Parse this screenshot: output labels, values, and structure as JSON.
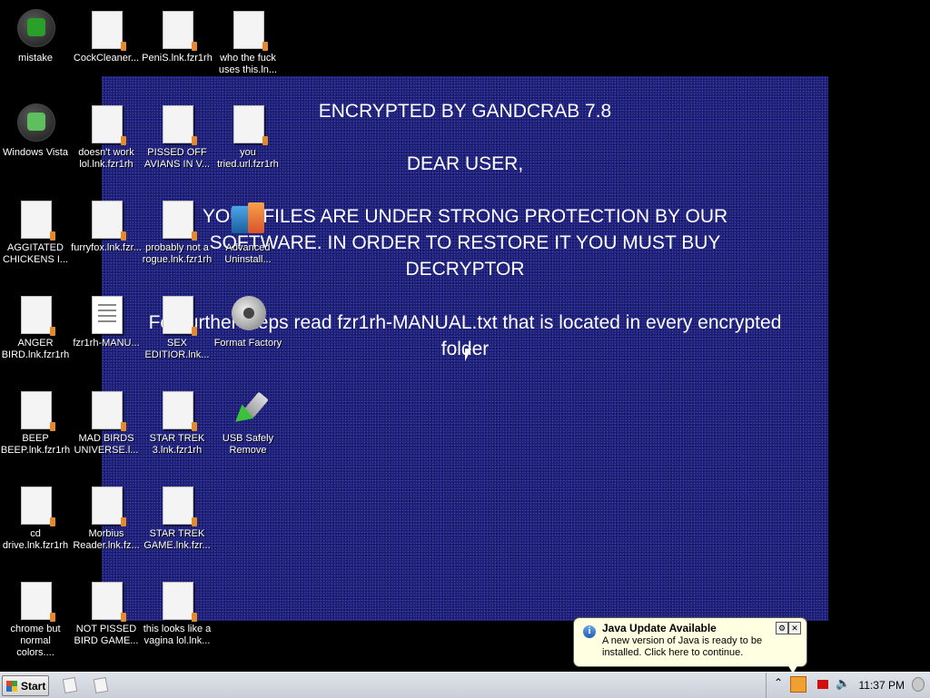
{
  "wallpaper": {
    "lines": [
      "ENCRYPTED BY GANDCRAB 7.8",
      "DEAR USER,",
      "YOUR FILES ARE UNDER STRONG PROTECTION BY OUR",
      "SOFTWARE. IN ORDER TO RESTORE IT YOU MUST BUY",
      "DECRYPTOR",
      "For further steps read fzr1rh-MANUAL.txt that is located in every encrypted",
      "folder"
    ],
    "color": "#1c1f7e"
  },
  "desktop": {
    "icons": [
      {
        "label": "mistake",
        "icon": "recycle-bin-icon"
      },
      {
        "label": "CockCleaner...",
        "icon": "file-icon"
      },
      {
        "label": "PeniS.lnk.fzr1rh",
        "icon": "file-icon"
      },
      {
        "label": "who the fuck uses this.ln...",
        "icon": "file-icon"
      },
      {
        "label": "Windows Vista",
        "icon": "recycle-bin-icon"
      },
      {
        "label": "doesn't work lol.lnk.fzr1rh",
        "icon": "file-icon"
      },
      {
        "label": "PISSED OFF AVIANS IN V...",
        "icon": "file-icon"
      },
      {
        "label": "you tried.url.fzr1rh",
        "icon": "file-icon"
      },
      {
        "label": "AGGITATED CHICKENS I...",
        "icon": "file-icon"
      },
      {
        "label": "furryfox.lnk.fzr...",
        "icon": "file-icon"
      },
      {
        "label": "probably not a rogue.lnk.fzr1rh",
        "icon": "file-icon"
      },
      {
        "label": "Advanced Uninstall...",
        "icon": "uninstaller-icon"
      },
      {
        "label": "ANGER BIRD.lnk.fzr1rh",
        "icon": "file-icon"
      },
      {
        "label": "fzr1rh-MANU...",
        "icon": "text-document-icon"
      },
      {
        "label": "SEX EDITIOR.lnk...",
        "icon": "file-icon"
      },
      {
        "label": "Format Factory",
        "icon": "format-factory-icon"
      },
      {
        "label": "BEEP BEEP.lnk.fzr1rh",
        "icon": "file-icon"
      },
      {
        "label": "MAD BIRDS UNIVERSE.l...",
        "icon": "file-icon"
      },
      {
        "label": "STAR TREK 3.lnk.fzr1rh",
        "icon": "file-icon"
      },
      {
        "label": "USB Safely Remove",
        "icon": "usb-icon"
      },
      {
        "label": "cd drive.lnk.fzr1rh",
        "icon": "file-icon"
      },
      {
        "label": "Morbius Reader.lnk.fz...",
        "icon": "file-icon"
      },
      {
        "label": "STAR TREK GAME.lnk.fzr...",
        "icon": "file-icon"
      },
      {
        "label": "chrome but normal colors....",
        "icon": "file-icon"
      },
      {
        "label": "NOT PISSED BIRD GAME...",
        "icon": "file-icon"
      },
      {
        "label": "this looks like a vagina lol.lnk...",
        "icon": "file-icon"
      }
    ]
  },
  "taskbar": {
    "start_label": "Start",
    "clock": "11:37 PM"
  },
  "balloon": {
    "title": "Java Update Available",
    "message": "A new version of Java is ready to be installed. Click here to continue.",
    "close_glyph": "✕",
    "options_glyph": "⚙"
  }
}
